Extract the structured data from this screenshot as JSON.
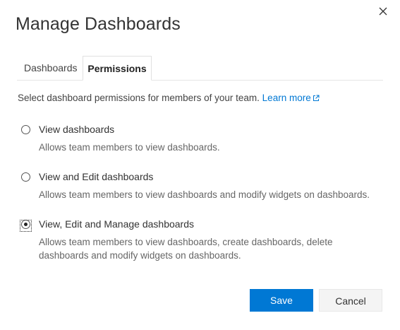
{
  "dialog": {
    "title": "Manage Dashboards"
  },
  "tabs": [
    {
      "label": "Dashboards",
      "selected": false
    },
    {
      "label": "Permissions",
      "selected": true
    }
  ],
  "permissions": {
    "description": "Select dashboard permissions for members of your team.",
    "learn_more": "Learn more",
    "options": [
      {
        "label": "View dashboards",
        "description": "Allows team members to view dashboards.",
        "selected": false
      },
      {
        "label": "View and Edit dashboards",
        "description": "Allows team members to view dashboards and modify widgets on dashboards.",
        "selected": false
      },
      {
        "label": "View, Edit and Manage dashboards",
        "description": "Allows team members to view dashboards, create dashboards, delete dashboards and modify widgets on dashboards.",
        "selected": true
      }
    ]
  },
  "footer": {
    "save_label": "Save",
    "cancel_label": "Cancel"
  },
  "colors": {
    "accent": "#0078d4",
    "text": "#333333",
    "muted": "#666666"
  },
  "icons": {
    "close": "close-icon",
    "external_link": "external-link-icon"
  }
}
